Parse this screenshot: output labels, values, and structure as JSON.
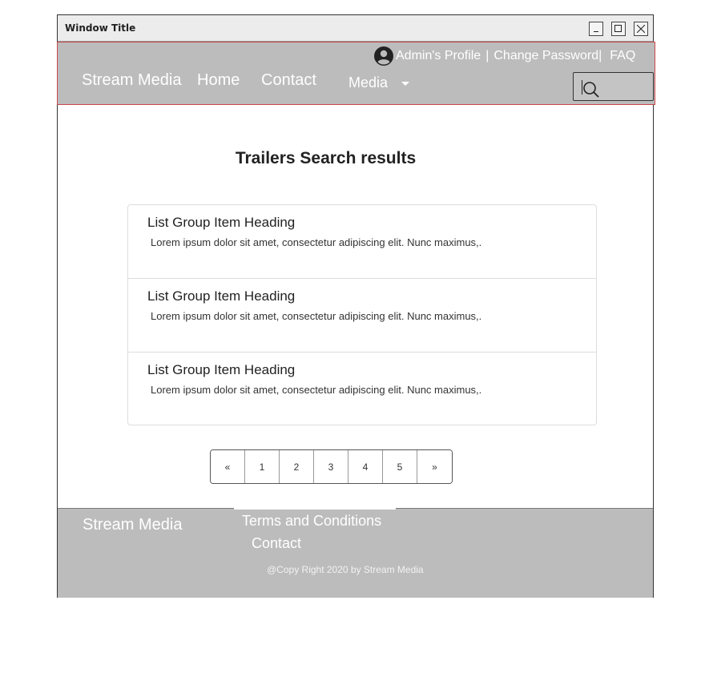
{
  "window": {
    "title": "Window Title",
    "controls": [
      "minimize-icon",
      "maximize-icon",
      "close-icon"
    ]
  },
  "navbar": {
    "brand": "Stream Media",
    "links": {
      "home": "Home",
      "contact": "Contact",
      "media": "Media"
    },
    "profile": {
      "admin": "Admin's Profile",
      "sep1": "|",
      "change_password": "Change Password",
      "sep2": "|",
      "faq": "FAQ"
    },
    "search": {
      "icon": "search-icon",
      "placeholder": ""
    }
  },
  "main": {
    "heading": "Trailers Search results",
    "items": [
      {
        "heading": "List Group Item Heading",
        "text": "Lorem ipsum dolor sit amet, consectetur adipiscing elit. Nunc maximus,."
      },
      {
        "heading": "List Group Item Heading",
        "text": "Lorem ipsum dolor sit amet, consectetur adipiscing elit. Nunc maximus,."
      },
      {
        "heading": "List Group Item Heading",
        "text": "Lorem ipsum dolor sit amet, consectetur adipiscing elit. Nunc maximus,."
      }
    ],
    "pagination": {
      "prev": "«",
      "pages": [
        "1",
        "2",
        "3",
        "4",
        "5"
      ],
      "next": "»"
    }
  },
  "footer": {
    "brand": "Stream Media",
    "terms": "Terms and Conditions",
    "contact": "Contact",
    "copyright": "@Copy Right 2020 by Stream Media"
  }
}
